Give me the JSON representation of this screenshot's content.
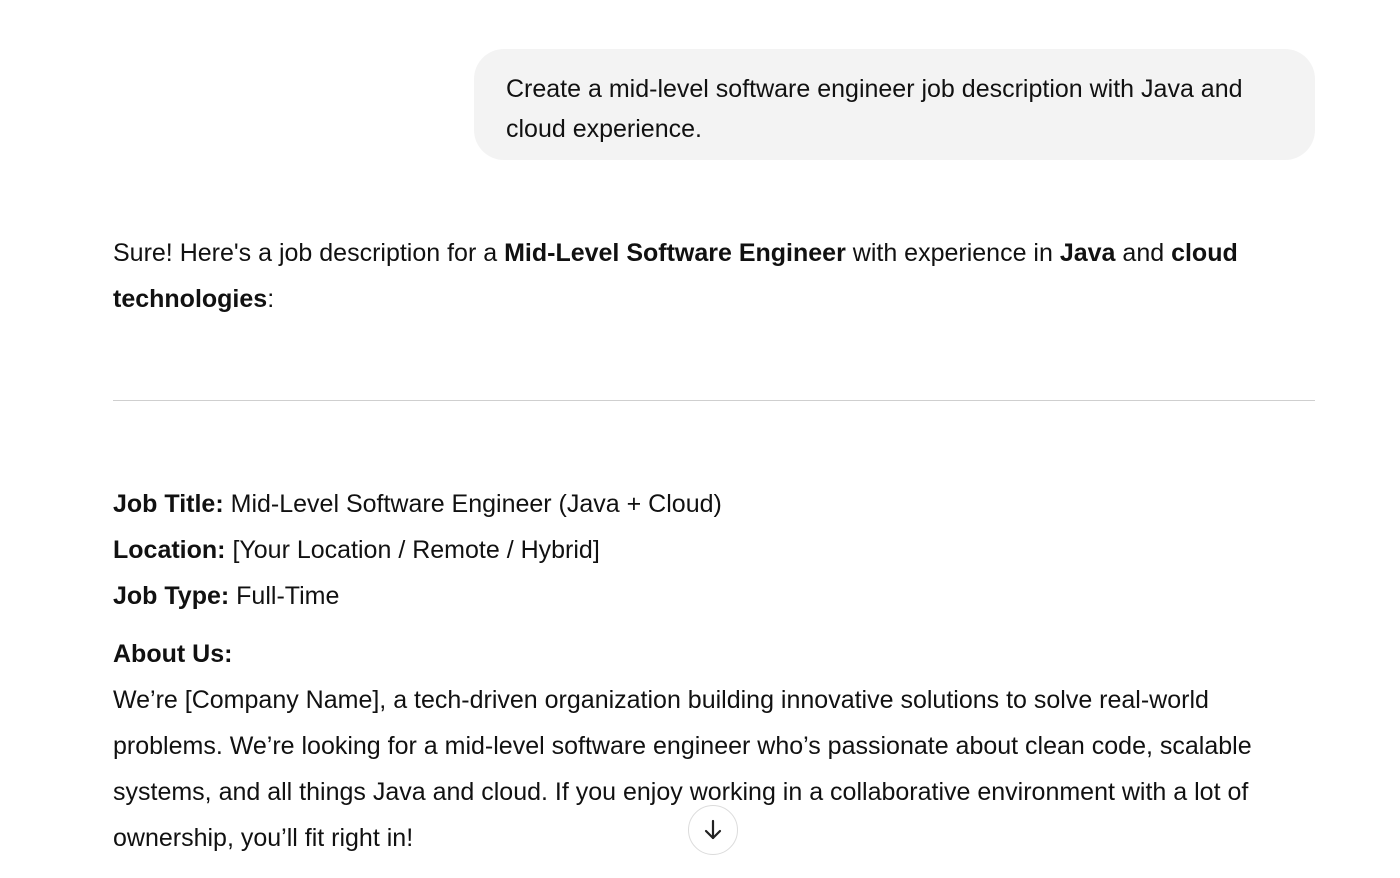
{
  "user_message": {
    "text": "Create a mid-level software engineer job description with Java and cloud experience."
  },
  "assistant": {
    "intro": {
      "t1": "Sure! Here's a job description for a ",
      "b1": "Mid-Level Software Engineer",
      "t2": " with experience in ",
      "b2": "Java",
      "t3": " and ",
      "b3": "cloud technologies",
      "t4": ":"
    },
    "job_title": {
      "label": "Job Title:",
      "value": " Mid-Level Software Engineer (Java + Cloud)"
    },
    "location": {
      "label": "Location:",
      "value": " [Your Location / Remote / Hybrid]"
    },
    "job_type": {
      "label": "Job Type:",
      "value": " Full-Time"
    },
    "about": {
      "heading": "About Us:",
      "body": "We’re [Company Name], a tech-driven organization building innovative solutions to solve real-world problems. We’re looking for a mid-level software engineer who’s passionate about clean code, scalable systems, and all things Java and cloud. If you enjoy working in a collaborative environment with a lot of ownership, you’ll fit right in!"
    }
  },
  "scroll_button": {
    "icon": "arrow-down-icon"
  },
  "colors": {
    "bubble_bg": "#f3f3f3",
    "text": "#111111",
    "divider": "#cfcfcf"
  }
}
